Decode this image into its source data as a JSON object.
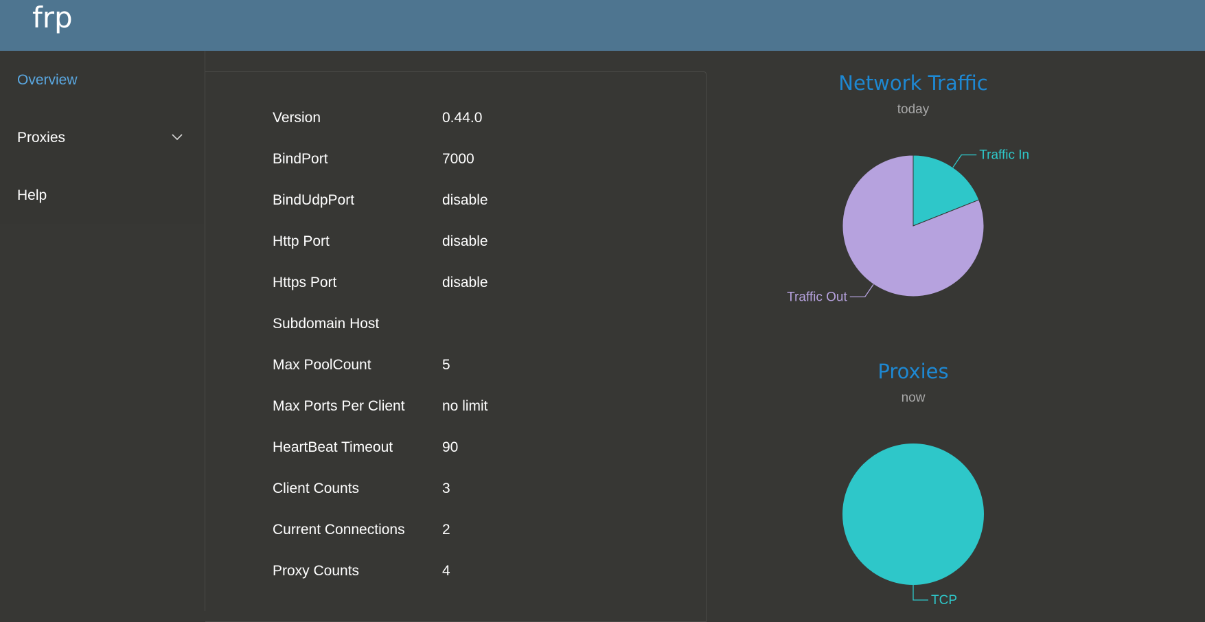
{
  "header": {
    "brand": "frp"
  },
  "sidebar": {
    "items": [
      {
        "label": "Overview",
        "active": true
      },
      {
        "label": "Proxies",
        "active": false,
        "has_submenu": true
      },
      {
        "label": "Help",
        "active": false
      }
    ]
  },
  "overview": {
    "rows": [
      {
        "label": "Version",
        "value": "0.44.0"
      },
      {
        "label": "BindPort",
        "value": "7000"
      },
      {
        "label": "BindUdpPort",
        "value": "disable"
      },
      {
        "label": "Http Port",
        "value": "disable"
      },
      {
        "label": "Https Port",
        "value": "disable"
      },
      {
        "label": "Subdomain Host",
        "value": ""
      },
      {
        "label": "Max PoolCount",
        "value": "5"
      },
      {
        "label": "Max Ports Per Client",
        "value": "no limit"
      },
      {
        "label": "HeartBeat Timeout",
        "value": "90"
      },
      {
        "label": "Client Counts",
        "value": "3"
      },
      {
        "label": "Current Connections",
        "value": "2"
      },
      {
        "label": "Proxy Counts",
        "value": "4"
      }
    ]
  },
  "chart_data": [
    {
      "type": "pie",
      "title": "Network Traffic",
      "subtitle": "today",
      "slices": [
        {
          "label": "Traffic In",
          "value": 19,
          "color": "#2ec7c9"
        },
        {
          "label": "Traffic Out",
          "value": 81,
          "color": "#b6a2de"
        }
      ]
    },
    {
      "type": "pie",
      "title": "Proxies",
      "subtitle": "now",
      "slices": [
        {
          "label": "TCP",
          "value": 100,
          "color": "#2ec7c9"
        }
      ]
    }
  ],
  "colors": {
    "header_bg": "#4e7590",
    "page_bg": "#373734",
    "accent": "#1e88d2",
    "nav_active": "#5aa7e0"
  },
  "icons": {
    "proxies_submenu": "chevron-down-icon"
  }
}
